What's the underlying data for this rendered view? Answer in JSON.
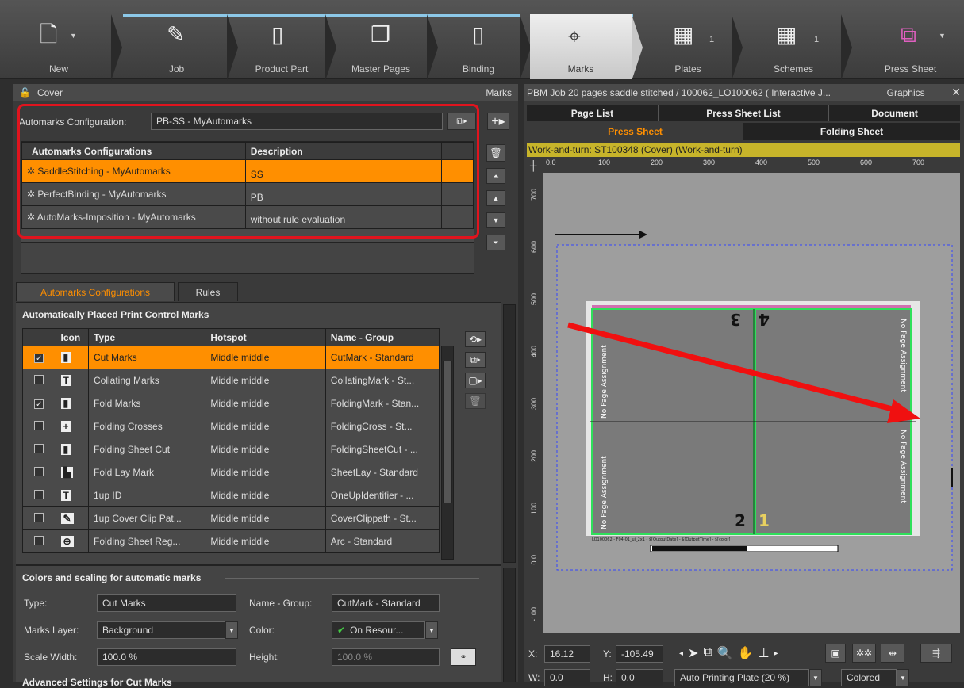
{
  "toolbar": {
    "items": [
      {
        "label": "New",
        "icon": "new-doc-icon",
        "count": ""
      },
      {
        "label": "Job",
        "icon": "job-icon",
        "count": ""
      },
      {
        "label": "Product Part",
        "icon": "product-part-icon",
        "count": ""
      },
      {
        "label": "Master Pages",
        "icon": "master-pages-icon",
        "count": ""
      },
      {
        "label": "Binding",
        "icon": "binding-icon",
        "count": ""
      },
      {
        "label": "Marks",
        "icon": "marks-icon",
        "count": ""
      },
      {
        "label": "Plates",
        "icon": "plates-icon",
        "count": "1"
      },
      {
        "label": "Schemes",
        "icon": "schemes-icon",
        "count": "1"
      },
      {
        "label": "Press Sheet",
        "icon": "press-sheet-icon",
        "count": ""
      }
    ]
  },
  "left": {
    "header_title": "Cover",
    "header_right": "Marks",
    "automarks_config_label": "Automarks Configuration:",
    "automarks_config_value": "PB-SS - MyAutomarks",
    "config_table": {
      "headers": [
        "Automarks Configurations",
        "Description"
      ],
      "rows": [
        {
          "name": "SaddleStitching - MyAutomarks",
          "desc": "SS"
        },
        {
          "name": "PerfectBinding - MyAutomarks",
          "desc": "PB"
        },
        {
          "name": "AutoMarks-Imposition - MyAutomarks",
          "desc": "without rule evaluation"
        }
      ]
    },
    "tabs": [
      "Automarks Configurations",
      "Rules"
    ],
    "placed_title": "Automatically Placed Print Control Marks",
    "marks_table": {
      "headers": [
        "Icon",
        "Type",
        "Hotspot",
        "Name - Group"
      ],
      "rows": [
        {
          "checked": "✓",
          "icon": "▮",
          "type": "Cut Marks",
          "hotspot": "Middle middle",
          "name": "CutMark - Standard"
        },
        {
          "checked": "",
          "icon": "T",
          "type": "Collating Marks",
          "hotspot": "Middle middle",
          "name": "CollatingMark - St..."
        },
        {
          "checked": "✓",
          "icon": "▮",
          "type": "Fold Marks",
          "hotspot": "Middle middle",
          "name": "FoldingMark - Stan..."
        },
        {
          "checked": "",
          "icon": "+",
          "type": "Folding Crosses",
          "hotspot": "Middle middle",
          "name": "FoldingCross - St..."
        },
        {
          "checked": "",
          "icon": "▮",
          "type": "Folding Sheet Cut",
          "hotspot": "Middle middle",
          "name": "FoldingSheetCut - ..."
        },
        {
          "checked": "",
          "icon": "▙",
          "type": "Fold Lay Mark",
          "hotspot": "Middle middle",
          "name": "SheetLay - Standard"
        },
        {
          "checked": "",
          "icon": "T",
          "type": "1up ID",
          "hotspot": "Middle middle",
          "name": "OneUpIdentifier - ..."
        },
        {
          "checked": "",
          "icon": "✎",
          "type": "1up Cover Clip Pat...",
          "hotspot": "Middle middle",
          "name": "CoverClippath - St..."
        },
        {
          "checked": "",
          "icon": "⊕",
          "type": "Folding Sheet Reg...",
          "hotspot": "Middle middle",
          "name": "Arc - Standard"
        }
      ]
    },
    "colors_title": "Colors and scaling for automatic marks",
    "type_label": "Type:",
    "type_value": "Cut Marks",
    "name_group_label": "Name - Group:",
    "name_group_value": "CutMark - Standard",
    "marks_layer_label": "Marks Layer:",
    "marks_layer_value": "Background",
    "color_label": "Color:",
    "color_value": "On Resour...",
    "scale_width_label": "Scale Width:",
    "scale_width_value": "100.0 %",
    "height_label": "Height:",
    "height_value": "100.0 %",
    "advanced_title": "Advanced Settings for Cut Marks"
  },
  "right": {
    "header_title": "PBM Job 20 pages saddle stitched / 100062_LO100062 ( Interactive J...",
    "header_right": "Graphics",
    "tabs_row1": [
      "Page List",
      "Press Sheet List",
      "Document"
    ],
    "tabs_row2": [
      "Press Sheet",
      "Folding Sheet"
    ],
    "banner": "Work-and-turn:  ST100348 (Cover) (Work-and-turn)",
    "ruler_h": [
      "0.0",
      "100",
      "200",
      "300",
      "400",
      "500",
      "600",
      "700"
    ],
    "ruler_v": [
      "700",
      "600",
      "500",
      "400",
      "300",
      "200",
      "100",
      "0.0",
      "-100"
    ],
    "page_labels": [
      "No Page Assignment",
      "No Page Assignment",
      "No Page Assignment",
      "No Page Assignment"
    ],
    "page_numbers": [
      "3",
      "4",
      "2",
      "1"
    ],
    "slug_text": "LO100062  -  F04-01_ui_2x1  -  $[OutputDate]  -  $[OutputTime]  -  $[color]",
    "x_label": "X:",
    "x_value": "16.12",
    "y_label": "Y:",
    "y_value": "-105.49",
    "w_label": "W:",
    "w_value": "0.0",
    "h_label": "H:",
    "h_value": "0.0",
    "plate_select": "Auto Printing Plate (20 %)",
    "color_mode": "Colored"
  },
  "colors": {
    "accent": "#ff8f00",
    "highlight_box": "#e0141e",
    "banner": "#c7b42a"
  }
}
